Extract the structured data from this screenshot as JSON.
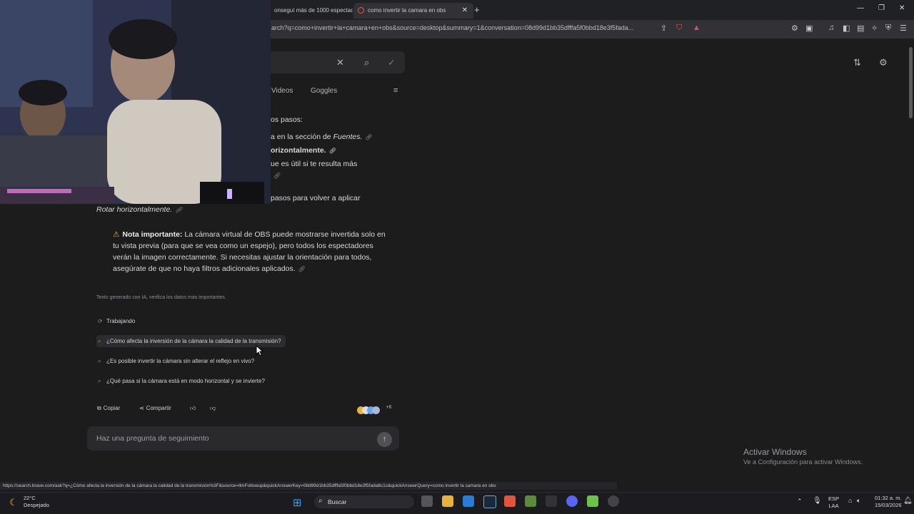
{
  "tabs": [
    {
      "label": "onseguí más de 1000 espectad"
    },
    {
      "label": "como invertir la camara en obs"
    }
  ],
  "address_bar": {
    "url": "arch?q=como+invertir+la+camara+en+obs&source=desktop&summary=1&conversation=08d99d1bb35dfffa5f0bbd18e3f5fada..."
  },
  "search": {
    "nav_tabs": [
      "Videos",
      "Goggles"
    ]
  },
  "answer": {
    "step_lines": [
      {
        "text": "os pasos:",
        "italic": ""
      },
      {
        "text": "a en la sección de ",
        "italic": "Fuentes."
      },
      {
        "text": "orizontalmente.",
        "bold": true
      },
      {
        "text": "ue es útil si te resulta más",
        "italic": ""
      },
      {
        "text": "pasos para volver a aplicar",
        "italic": ""
      }
    ],
    "rotate_text": "Rotar horizontalmente.",
    "note_label": "Nota importante:",
    "note_text": "La cámara virtual de OBS puede mostrarse invertida solo en tu vista previa (para que se vea como un espejo), pero todos los espectadores verán la imagen correctamente. Si necesitas ajustar la orientación para todos, asegúrate de que no haya filtros adicionales aplicados.",
    "disclaimer": "Texto generado con IA, verifica los datos más importantes.",
    "working": "Trabajando",
    "suggestions": [
      "¿Cómo afecta la inversión de la cámara la calidad de la transmisión?",
      "¿Es posible invertir la cámara sin alterar el reflejo en vivo?",
      "¿Qué pasa si la cámara está en modo horizontal y se invierte?"
    ],
    "copy_label": "Copiar",
    "share_label": "Compartir",
    "sources_count": "+6"
  },
  "followup": {
    "placeholder": "Haz una pregunta de seguimiento"
  },
  "watermark": {
    "line1": "Activar Windows",
    "line2": "Ve a Configuración para activar Windows."
  },
  "status_url": "https://search.brave.com/ask?q=¿Cómo afecta la inversión de la cámara la calidad de la transmisión%3F&source=llmFollowup&quickAnswerKey=08d99d1bb35dfffa5f0bbd18e3f5fada8c1c&quickAnswerQuery=como invertir la camara en obs",
  "taskbar": {
    "weather_temp": "22°C",
    "weather_desc": "Despejado",
    "search_label": "Buscar",
    "lang": "ESP",
    "lang2": "LAA",
    "time": "01:32 a. m.",
    "date": "15/03/2026"
  }
}
